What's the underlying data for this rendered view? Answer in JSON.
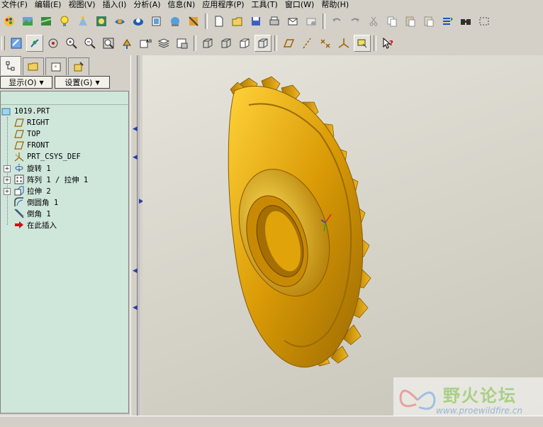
{
  "menu": [
    {
      "label": "文件(F)",
      "name": "menu-file"
    },
    {
      "label": "编辑(E)",
      "name": "menu-edit"
    },
    {
      "label": "视图(V)",
      "name": "menu-view"
    },
    {
      "label": "插入(I)",
      "name": "menu-insert"
    },
    {
      "label": "分析(A)",
      "name": "menu-analysis"
    },
    {
      "label": "信息(N)",
      "name": "menu-info"
    },
    {
      "label": "应用程序(P)",
      "name": "menu-applications"
    },
    {
      "label": "工具(T)",
      "name": "menu-tools"
    },
    {
      "label": "窗口(W)",
      "name": "menu-window"
    },
    {
      "label": "帮助(H)",
      "name": "menu-help"
    }
  ],
  "panel": {
    "show_label": "显示(O)",
    "settings_label": "设置(G)"
  },
  "tree": {
    "root": "1019.PRT",
    "items": [
      {
        "label": "RIGHT",
        "icon": "datum-plane-icon"
      },
      {
        "label": "TOP",
        "icon": "datum-plane-icon"
      },
      {
        "label": "FRONT",
        "icon": "datum-plane-icon"
      },
      {
        "label": "PRT_CSYS_DEF",
        "icon": "coordinate-system-icon"
      },
      {
        "label": "旋转 1",
        "icon": "revolve-icon"
      },
      {
        "label": "阵列 1 / 拉伸 1",
        "icon": "pattern-icon"
      },
      {
        "label": "拉伸 2",
        "icon": "extrude-icon"
      },
      {
        "label": "倒圆角 1",
        "icon": "round-icon"
      },
      {
        "label": "倒角 1",
        "icon": "chamfer-icon"
      },
      {
        "label": "在此插入",
        "icon": "insert-here-arrow-icon"
      }
    ]
  },
  "watermark": {
    "title": "野火论坛",
    "url": "www.proewildfire.cn"
  },
  "colors": {
    "gear_gold": "#e0a008",
    "tree_bg": "#cfe6da",
    "viewport_bg": "#d8d6cb"
  }
}
